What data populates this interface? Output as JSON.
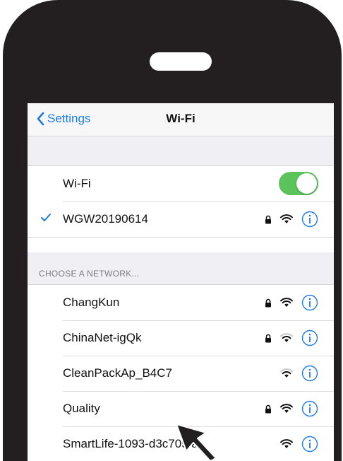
{
  "navbar": {
    "back_label": "Settings",
    "title": "Wi-Fi"
  },
  "wifi_toggle": {
    "label": "Wi-Fi",
    "state": "on",
    "color": "#5ac35a"
  },
  "connected_network": {
    "name": "WGW20190614",
    "secured": true
  },
  "section": {
    "header": "CHOOSE A NETWORK..."
  },
  "networks": [
    {
      "name": "ChangKun",
      "secured": true
    },
    {
      "name": "ChinaNet-igQk",
      "secured": true
    },
    {
      "name": "CleanPackAp_B4C7",
      "secured": false
    },
    {
      "name": "Quality",
      "secured": true
    },
    {
      "name": "SmartLife-1093-d3c705fa",
      "secured": false
    }
  ],
  "colors": {
    "accent": "#1f7ae0",
    "toggle_on": "#5ac35a",
    "phone_body": "#231f20"
  }
}
